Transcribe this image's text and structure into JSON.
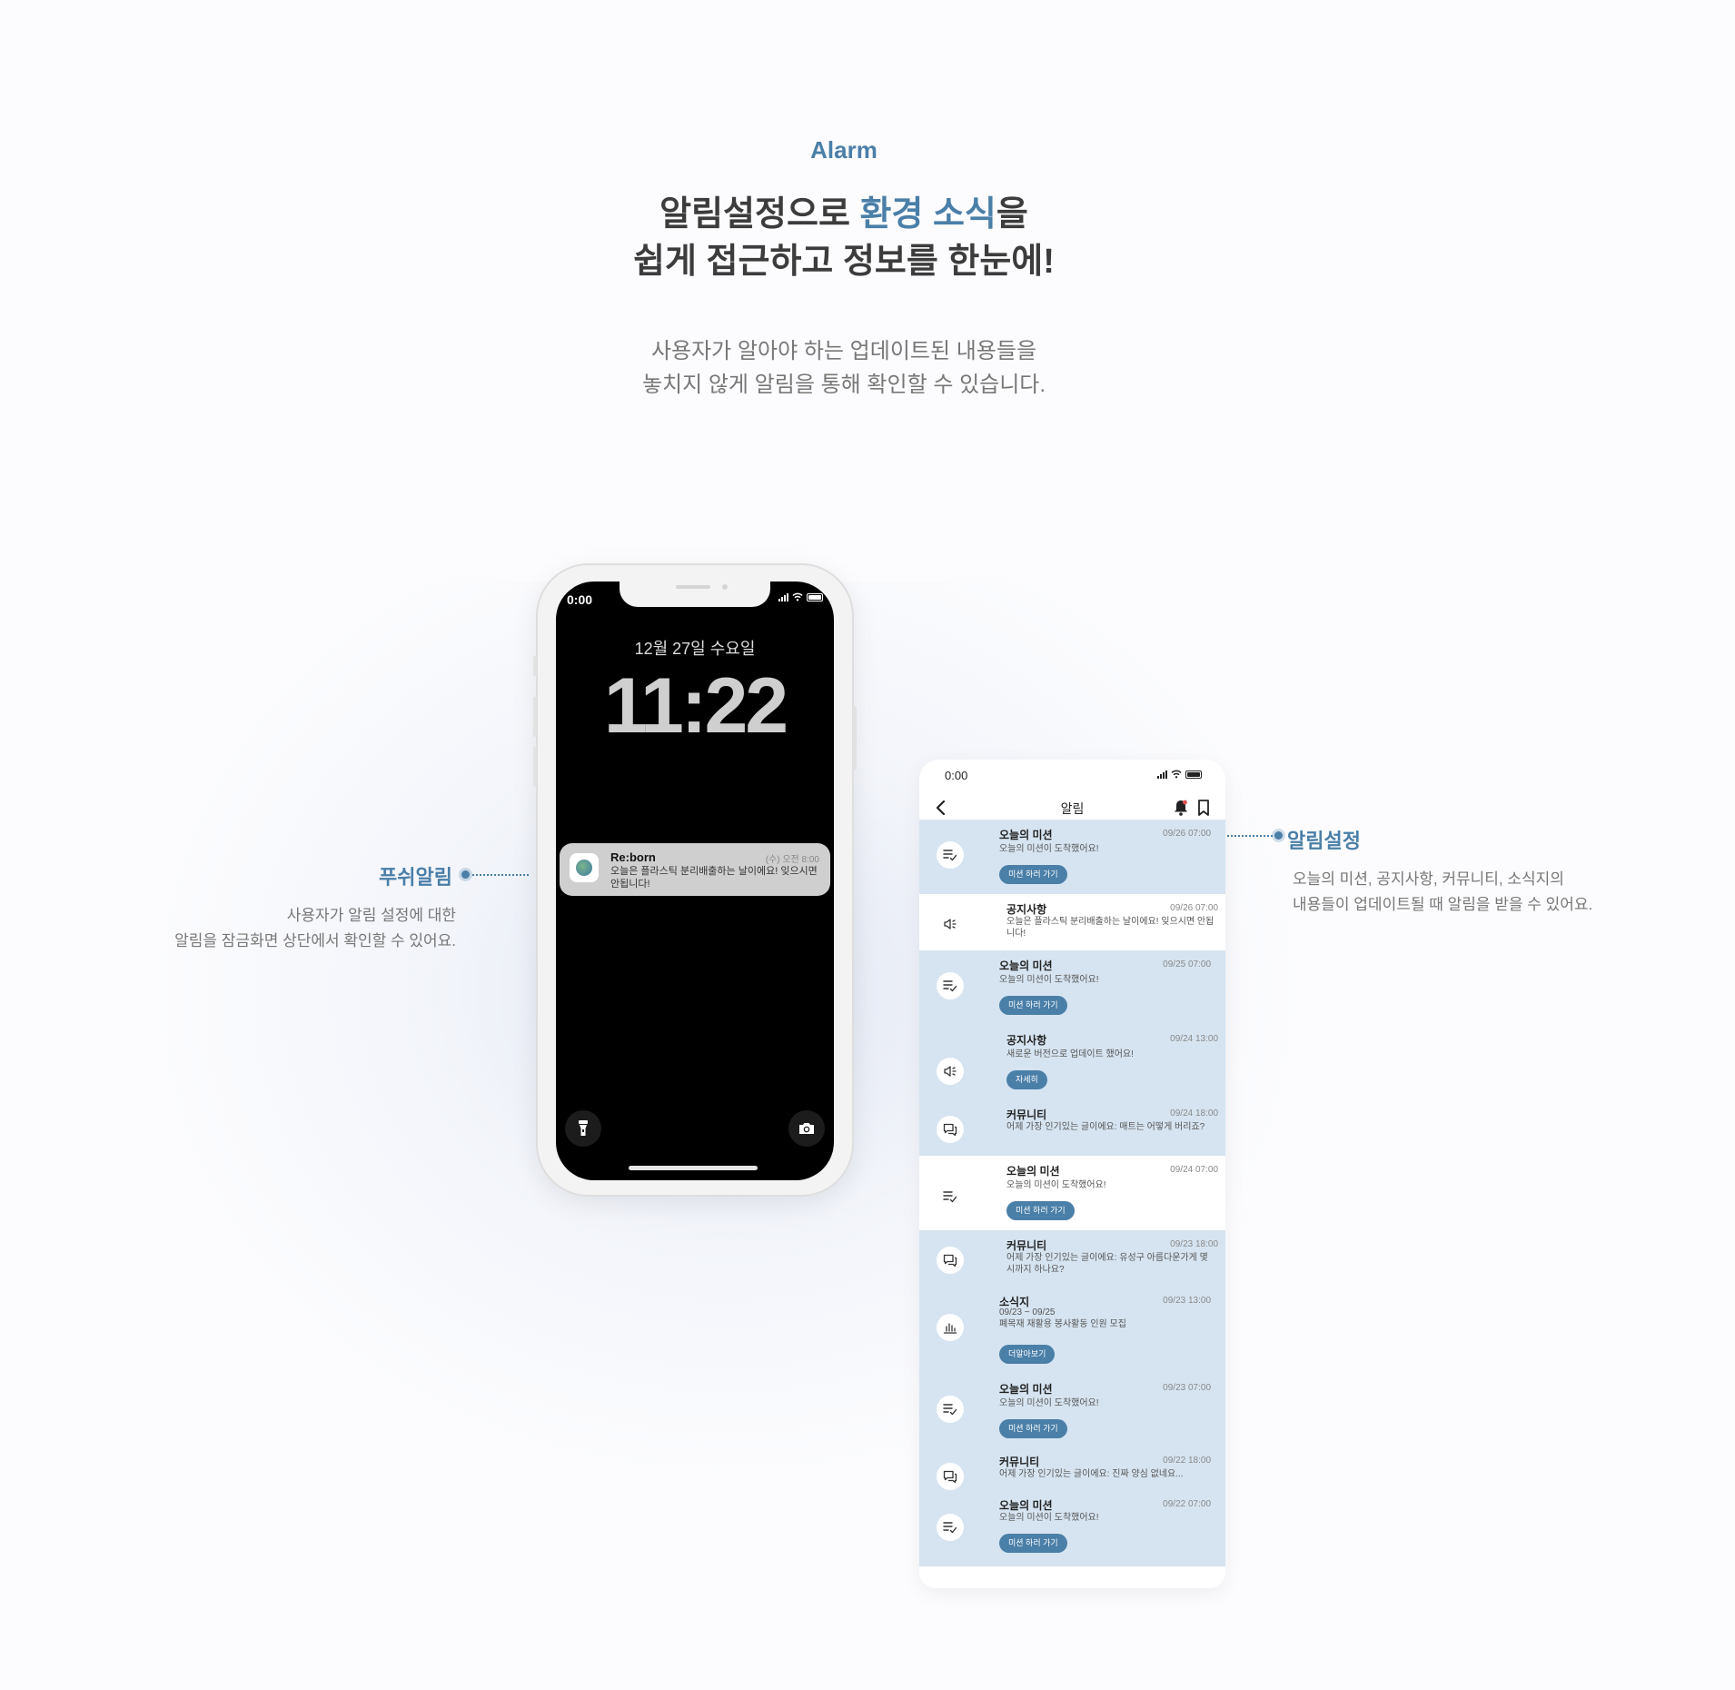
{
  "header": {
    "eyebrow": "Alarm",
    "headline_line1_pre": "알림설정으로 ",
    "headline_line1_highlight": "환경 소식",
    "headline_line1_post": "을",
    "headline_line2": "쉽게 접근하고 정보를 한눈에!",
    "subcopy_line1": "사용자가 알아야 하는 업데이트된 내용들을",
    "subcopy_line2": "놓치지 않게 알림을 통해 확인할 수 있습니다."
  },
  "colors": {
    "accent": "#4a7fa8",
    "unread_bg": "#d6e4f1",
    "lockscreen_bg": "#000000"
  },
  "lockscreen": {
    "status_time": "0:00",
    "date": "12월 27일 수요일",
    "clock": "11:22",
    "notification": {
      "app_name": "Re:born",
      "time": "(수) 오전 8:00",
      "message": "오늘은 플라스틱 분리배출하는 날이에요! 잊으시면 안됩니다!"
    },
    "left_button_icon": "flashlight-icon",
    "right_button_icon": "camera-icon"
  },
  "callout_left": {
    "title": "푸쉬알림",
    "desc_line1": "사용자가 알림 설정에 대한",
    "desc_line2": "알림을 잠금화면 상단에서 확인할 수 있어요."
  },
  "callout_right": {
    "title": "알림설정",
    "desc_line1": "오늘의 미션, 공지사항, 커뮤니티, 소식지의",
    "desc_line2": "내용들이 업데이트될 때 알림을 받을 수 있어요."
  },
  "app": {
    "status_time": "0:00",
    "title": "알림",
    "notifications": [
      {
        "icon": "checklist-icon",
        "title": "오늘의 미션",
        "time": "09/26 07:00",
        "message": "오늘의 미션이 도착했어요!",
        "button": "미션 하러 가기",
        "read": false
      },
      {
        "icon": "megaphone-icon",
        "title": "공지사항",
        "time": "09/26 07:00",
        "message": "오늘은 플라스틱 분리배출하는 날이에요! 잊으시면 안됩니다!",
        "button": "",
        "read": true
      },
      {
        "icon": "checklist-icon",
        "title": "오늘의 미션",
        "time": "09/25 07:00",
        "message": "오늘의 미션이 도착했어요!",
        "button": "미션 하러 가기",
        "read": false
      },
      {
        "icon": "megaphone-icon",
        "title": "공지사항",
        "time": "09/24 13:00",
        "message": "새로운 버전으로 업데이트 했어요!",
        "button": "자세히",
        "read": false
      },
      {
        "icon": "chat-icon",
        "title": "커뮤니티",
        "time": "09/24 18:00",
        "message": "어제 가장 인기있는 글이에요: 매트는 어떻게 버리죠?",
        "button": "",
        "read": false
      },
      {
        "icon": "checklist-icon",
        "title": "오늘의 미션",
        "time": "09/24 07:00",
        "message": "오늘의 미션이 도착했어요!",
        "button": "미션 하러 가기",
        "read": true
      },
      {
        "icon": "chat-icon",
        "title": "커뮤니티",
        "time": "09/23 18:00",
        "message": "어제 가장 인기있는 글이에요: 유성구 아름다운가게 몇시까지 하나요?",
        "button": "",
        "read": false
      },
      {
        "icon": "chart-icon",
        "title": "소식지",
        "time": "09/23 13:00",
        "message_date": "09/23 ~ 09/25",
        "message": "폐목재 재활용 봉사활동 인원 모집",
        "button": "더알아보기",
        "read": false
      },
      {
        "icon": "checklist-icon",
        "title": "오늘의 미션",
        "time": "09/23 07:00",
        "message": "오늘의 미션이 도착했어요!",
        "button": "미션 하러 가기",
        "read": false
      },
      {
        "icon": "chat-icon",
        "title": "커뮤니티",
        "time": "09/22 18:00",
        "message": "어제 가장 인기있는 글이에요: 진짜 양심 없네요...",
        "button": "",
        "read": false
      },
      {
        "icon": "checklist-icon",
        "title": "오늘의 미션",
        "time": "09/22 07:00",
        "message": "오늘의 미션이 도착했어요!",
        "button": "미션 하러 가기",
        "read": false
      }
    ]
  }
}
